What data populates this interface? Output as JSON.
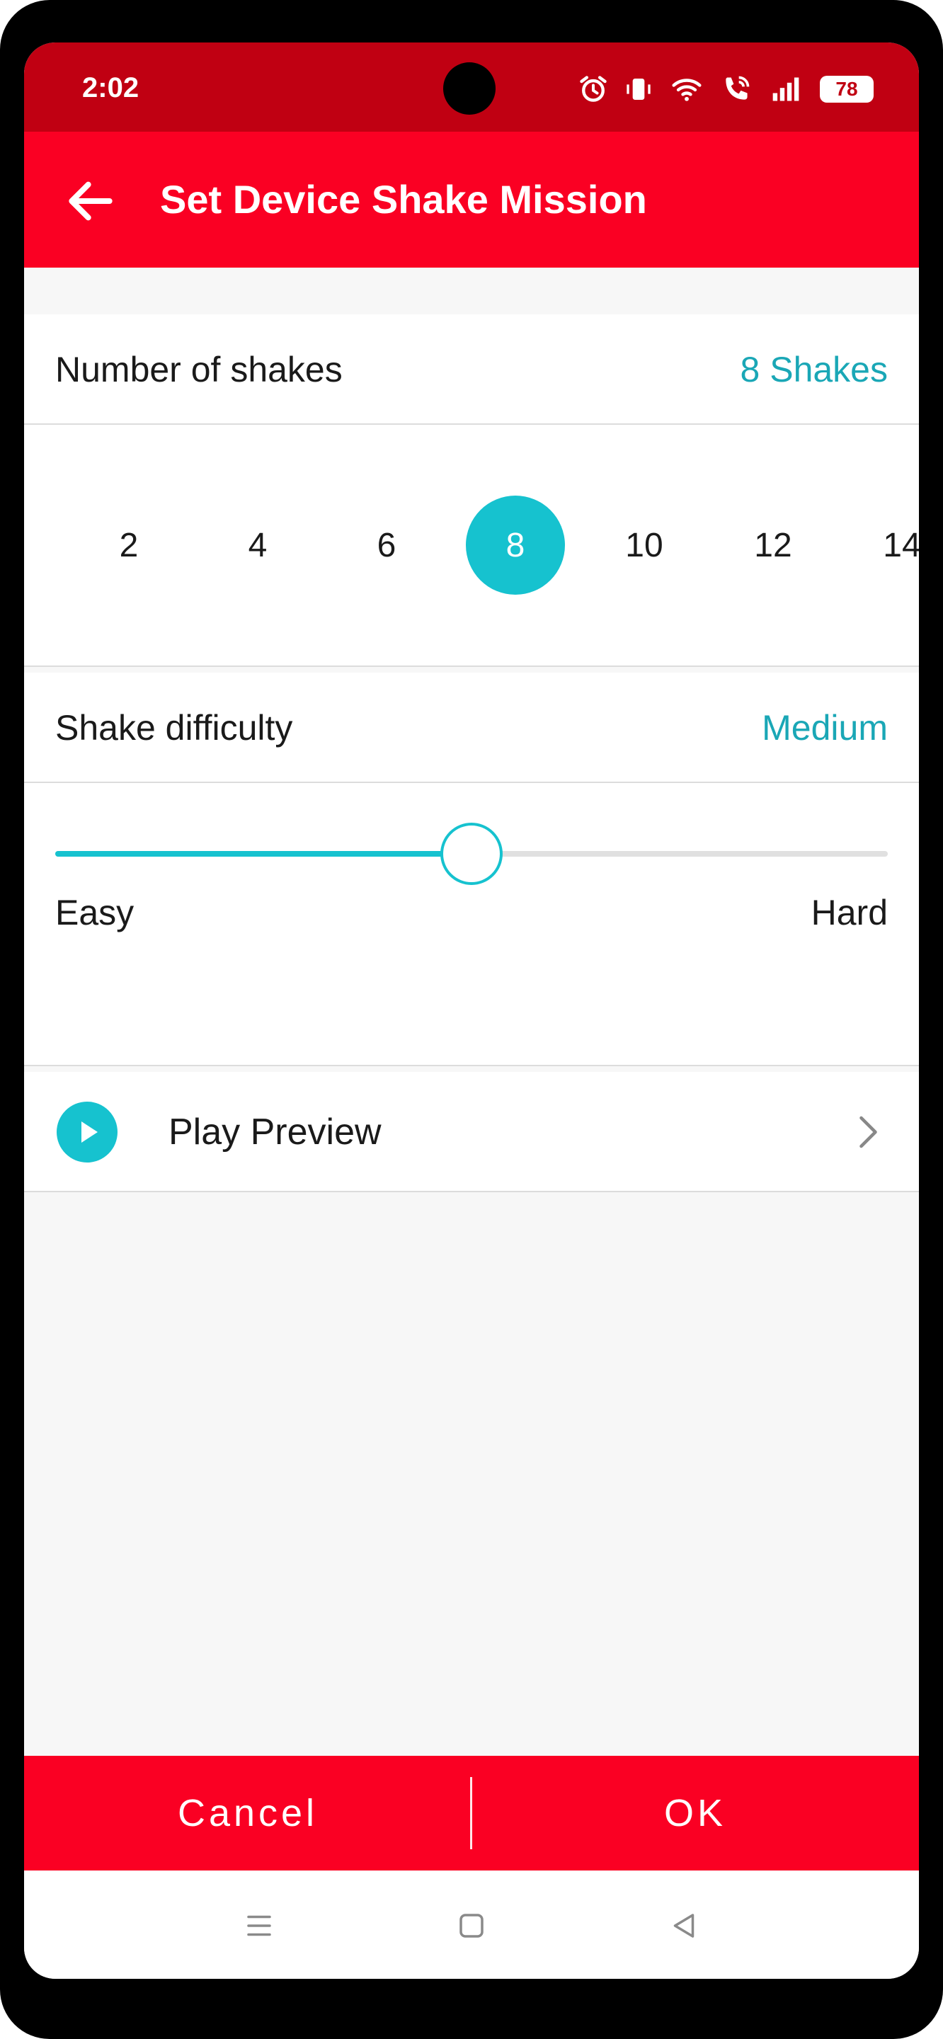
{
  "status_bar": {
    "time": "2:02",
    "battery": "78"
  },
  "app_bar": {
    "title": "Set Device Shake Mission"
  },
  "shakes": {
    "label": "Number of shakes",
    "value": "8 Shakes",
    "options": [
      "2",
      "4",
      "6",
      "8",
      "10",
      "12",
      "14"
    ],
    "selected": "8"
  },
  "difficulty": {
    "label": "Shake difficulty",
    "value": "Medium",
    "min_label": "Easy",
    "max_label": "Hard",
    "level_fraction": 0.5
  },
  "preview": {
    "label": "Play Preview"
  },
  "buttons": {
    "cancel": "Cancel",
    "ok": "OK"
  },
  "colors": {
    "accent": "#16c2cf",
    "brand": "#fa0023",
    "status_bar": "#c00012"
  },
  "icons": {
    "back": "arrow-left-icon",
    "alarm": "alarm-icon",
    "vibrate": "vibrate-icon",
    "wifi": "wifi-icon",
    "call": "wifi-call-icon",
    "signal": "signal-icon",
    "play": "play-circle-icon",
    "chevron": "chevron-right-icon",
    "nav_recents": "recents-icon",
    "nav_home": "home-icon",
    "nav_back": "back-triangle-icon"
  }
}
